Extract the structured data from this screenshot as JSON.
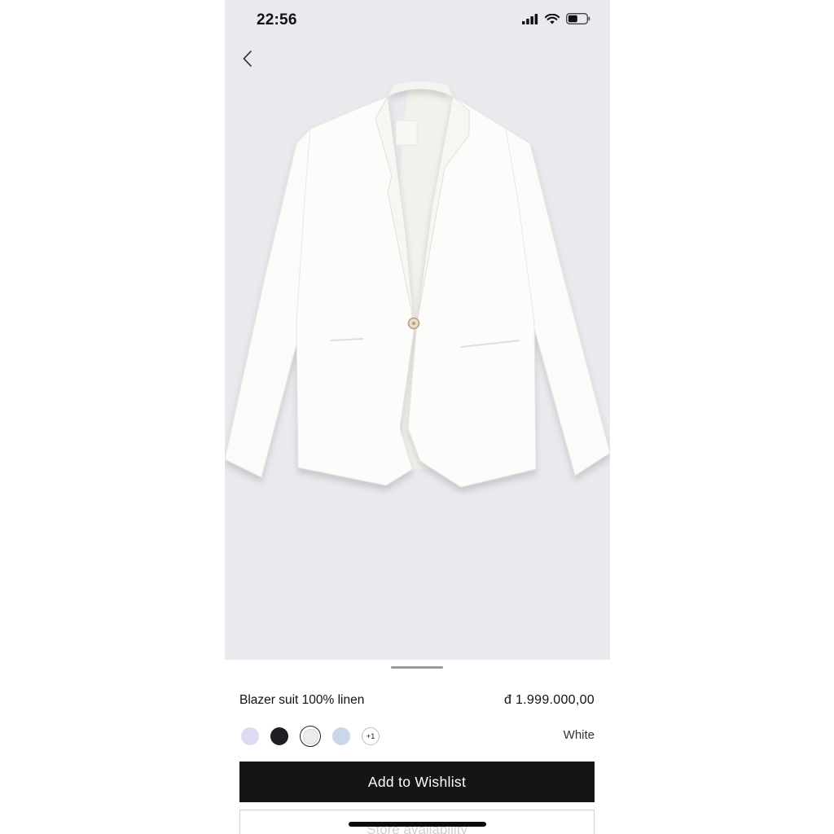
{
  "status_bar": {
    "time": "22:56",
    "icons": [
      "cellular-signal-icon",
      "wifi-icon",
      "battery-icon"
    ]
  },
  "navigation": {
    "back_icon": "chevron-left-icon"
  },
  "product": {
    "image_subject": "white-linen-blazer",
    "name": "Blazer suit 100% linen",
    "price": "đ 1.999.000,00",
    "selected_color": "White",
    "colors": [
      {
        "name": "lavender",
        "hex": "#dcdbf0"
      },
      {
        "name": "black",
        "hex": "#1e1e23"
      },
      {
        "name": "white",
        "hex": "#ececec",
        "selected": true
      },
      {
        "name": "light-blue",
        "hex": "#c9d7e6"
      }
    ],
    "more_colors_label": "+1"
  },
  "actions": {
    "wishlist_label": "Add to Wishlist",
    "store_label": "Store availability"
  },
  "theme": {
    "hero_background": "#e9eaee",
    "button_background": "#151515",
    "button_text": "#ffffff"
  }
}
